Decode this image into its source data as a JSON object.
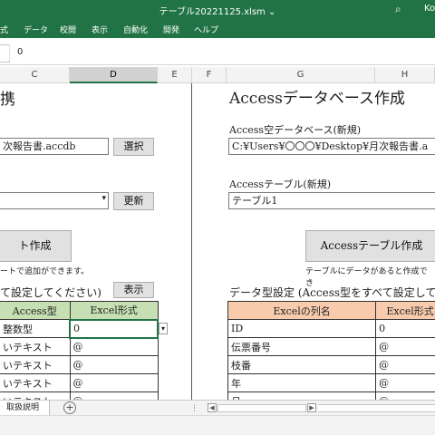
{
  "window": {
    "title": "テーブル20221125.xlsm ⌄",
    "user": "Ko"
  },
  "ribbon": {
    "tabs": [
      "式",
      "データ",
      "校閲",
      "表示",
      "自動化",
      "開発",
      "ヘルプ"
    ]
  },
  "formula_bar": {
    "value": "0"
  },
  "columns": [
    "C",
    "D",
    "E",
    "F",
    "G",
    "H"
  ],
  "left_panel": {
    "title_fragment": "携",
    "db_file": "次報告書.accdb",
    "select_button": "選択",
    "table_dropdown": "",
    "update_button": "更新",
    "create_button": "ト作成",
    "note": "ートで追加ができます。",
    "section_label": "て設定してください)",
    "show_button": "表示",
    "table": {
      "headers": [
        "Access型",
        "Excel形式"
      ],
      "rows": [
        [
          "整数型",
          "0"
        ],
        [
          "いテキスト",
          "@"
        ],
        [
          "いテキスト",
          "@"
        ],
        [
          "いテキスト",
          "@"
        ],
        [
          "いテキスト",
          "@"
        ]
      ]
    }
  },
  "right_panel": {
    "title": "Accessデータベース作成",
    "db_label": "Access空データベース(新規)",
    "db_path": "C:¥Users¥〇〇〇¥Desktop¥月次報告書.a",
    "table_label": "Accessテーブル(新規)",
    "table_name": "テーブル1",
    "create_button": "Accessテーブル作成",
    "note": "テーブルにデータがあると作成でき",
    "section_label": "データ型設定 (Access型をすべて設定して",
    "table": {
      "headers": [
        "Excelの列名",
        "Excel形式"
      ],
      "rows": [
        [
          "ID",
          "0"
        ],
        [
          "伝票番号",
          "@"
        ],
        [
          "枝番",
          "@"
        ],
        [
          "年",
          "@"
        ],
        [
          "月",
          "@"
        ]
      ]
    }
  },
  "sheet_tabs": {
    "active": "取扱説明",
    "add": "+"
  },
  "colors": {
    "excel_green": "#217346",
    "header_green": "#c6e0b4",
    "header_orange": "#f8cbad"
  }
}
